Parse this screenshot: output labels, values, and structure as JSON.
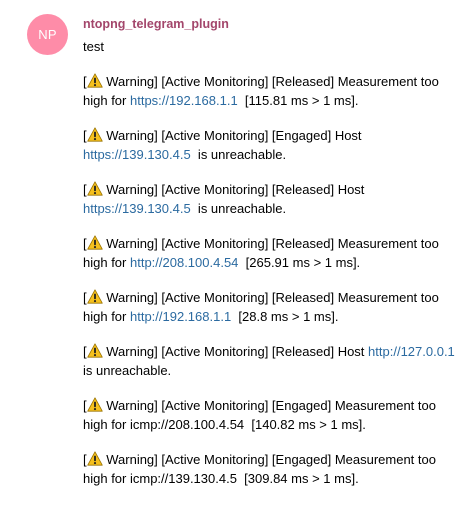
{
  "colors": {
    "avatar_bg": "#fe8ca8",
    "sender_name": "#a3466b",
    "link": "#2b6aa0",
    "warning_fill": "#f5c01d",
    "warning_stroke": "#9a7300"
  },
  "avatar": {
    "initials": "NP"
  },
  "sender": {
    "name": "ntopng_telegram_plugin"
  },
  "message": {
    "first_line": "test",
    "entries": [
      {
        "line1": {
          "pre": "[",
          "icon": "warning-icon",
          "text": " Warning] [Active Monitoring] [Released] Measurement too"
        },
        "line2": {
          "before": "high for ",
          "link": "https://192.168.1.1",
          "after": "  [115.81 ms > 1 ms]."
        }
      },
      {
        "line1": {
          "pre": "[",
          "icon": "warning-icon",
          "text": " Warning] [Active Monitoring] [Engaged] Host"
        },
        "line2": {
          "before": "",
          "link": "https://139.130.4.5",
          "after": "  is unreachable."
        }
      },
      {
        "line1": {
          "pre": "[",
          "icon": "warning-icon",
          "text": " Warning] [Active Monitoring] [Released] Host"
        },
        "line2": {
          "before": "",
          "link": "https://139.130.4.5",
          "after": "  is unreachable."
        }
      },
      {
        "line1": {
          "pre": "[",
          "icon": "warning-icon",
          "text": " Warning] [Active Monitoring] [Released] Measurement too"
        },
        "line2": {
          "before": "high for ",
          "link": "http://208.100.4.54",
          "after": "  [265.91 ms > 1 ms]."
        }
      },
      {
        "line1": {
          "pre": "[",
          "icon": "warning-icon",
          "text": " Warning] [Active Monitoring] [Released] Measurement too"
        },
        "line2": {
          "before": "high for ",
          "link": "http://192.168.1.1",
          "after": "  [28.8 ms > 1 ms]."
        }
      },
      {
        "line1": {
          "pre": "[",
          "icon": "warning-icon",
          "text": " Warning] [Active Monitoring] [Released] Host ",
          "link": "http://127.0.0.1"
        },
        "line2": {
          "before": "is unreachable.",
          "link": "",
          "after": ""
        }
      },
      {
        "line1": {
          "pre": "[",
          "icon": "warning-icon",
          "text": " Warning] [Active Monitoring] [Engaged] Measurement too"
        },
        "line2": {
          "before": "high for icmp://208.100.4.54  [140.82 ms > 1 ms].",
          "link": "",
          "after": ""
        }
      },
      {
        "line1": {
          "pre": "[",
          "icon": "warning-icon",
          "text": " Warning] [Active Monitoring] [Engaged] Measurement too"
        },
        "line2": {
          "before": "high for icmp://139.130.4.5  [309.84 ms > 1 ms].",
          "link": "",
          "after": ""
        }
      }
    ]
  }
}
